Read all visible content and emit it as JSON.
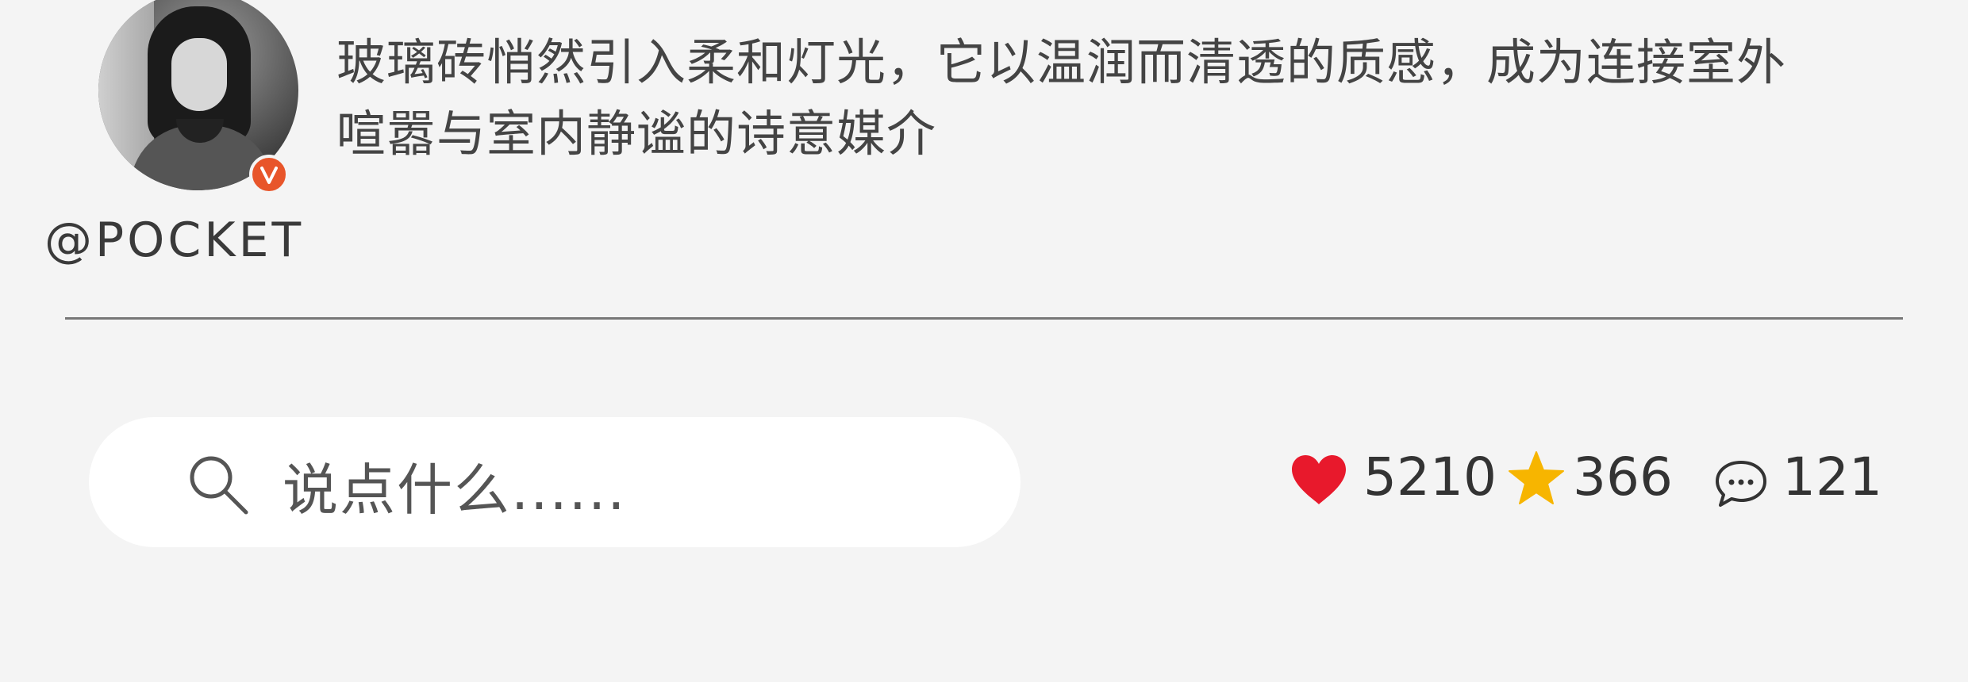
{
  "post": {
    "author_handle": "@POCKET",
    "verified_badge_letter": "V",
    "description": "玻璃砖悄然引入柔和灯光，它以温润而清透的质感，成为连接室外喧嚣与室内静谧的诗意媒介"
  },
  "comment_input": {
    "placeholder": "说点什么......"
  },
  "stats": {
    "likes": "5210",
    "favorites": "366",
    "comments": "121"
  },
  "colors": {
    "background": "#f4f4f4",
    "like_heart": "#e8192c",
    "favorite_star": "#f7b500",
    "verified_badge": "#e8552a"
  },
  "icons": {
    "like": "heart-icon",
    "favorite": "star-icon",
    "comment": "comment-bubble-icon",
    "search": "search-icon"
  }
}
